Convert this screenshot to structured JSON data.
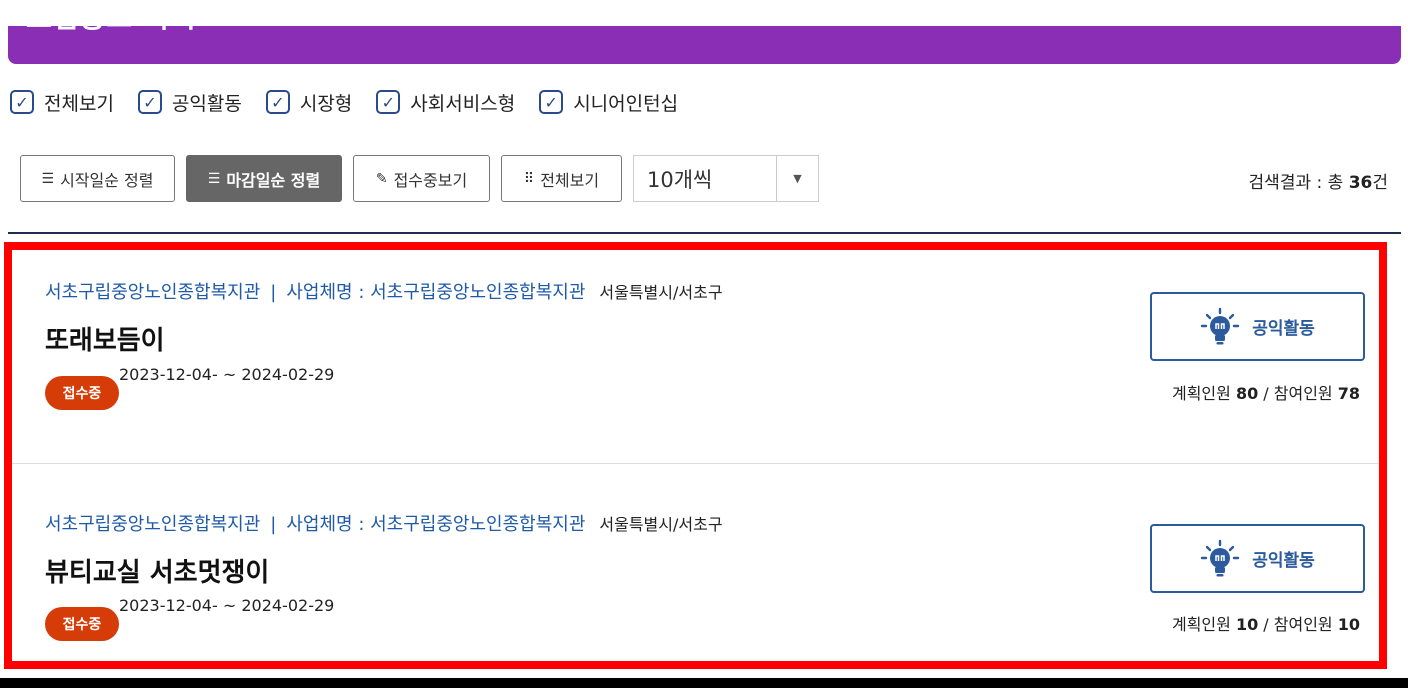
{
  "header": {
    "title": "모집공고 목록"
  },
  "filters": [
    {
      "label": "전체보기",
      "checked": true
    },
    {
      "label": "공익활동",
      "checked": true
    },
    {
      "label": "시장형",
      "checked": true
    },
    {
      "label": "사회서비스형",
      "checked": true
    },
    {
      "label": "시니어인턴십",
      "checked": true
    }
  ],
  "toolbar": {
    "sort_start": "시작일순 정렬",
    "sort_deadline": "마감일순 정렬",
    "receiving": "접수중보기",
    "view_all": "전체보기",
    "page_size": "10개씩"
  },
  "result": {
    "prefix": "검색결과 : 총 ",
    "count": "36",
    "suffix": "건"
  },
  "postings": [
    {
      "org": "서초구립중앙노인종합복지관",
      "separator": "|",
      "business": "사업체명 : 서초구립중앙노인종합복지관",
      "location": "서울특별시/서초구",
      "title": "또래보듬이",
      "status": "접수중",
      "period": "2023-12-04- ~ 2024-02-29",
      "type": "공익활동",
      "planned_label": "계획인원 ",
      "planned": "80",
      "participants_label": " / 참여인원 ",
      "participants": "78"
    },
    {
      "org": "서초구립중앙노인종합복지관",
      "separator": "|",
      "business": "사업체명 : 서초구립중앙노인종합복지관",
      "location": "서울특별시/서초구",
      "title": "뷰티교실 서초멋쟁이",
      "status": "접수중",
      "period": "2023-12-04- ~ 2024-02-29",
      "type": "공익활동",
      "planned_label": "계획인원 ",
      "planned": "10",
      "participants_label": " / 참여인원 ",
      "participants": "10"
    }
  ],
  "colors": {
    "header": "#8a2fb5",
    "link": "#1f5aa8",
    "badge": "#d63c08",
    "type_border": "#2b5b9c",
    "highlight": "#ff0000"
  }
}
